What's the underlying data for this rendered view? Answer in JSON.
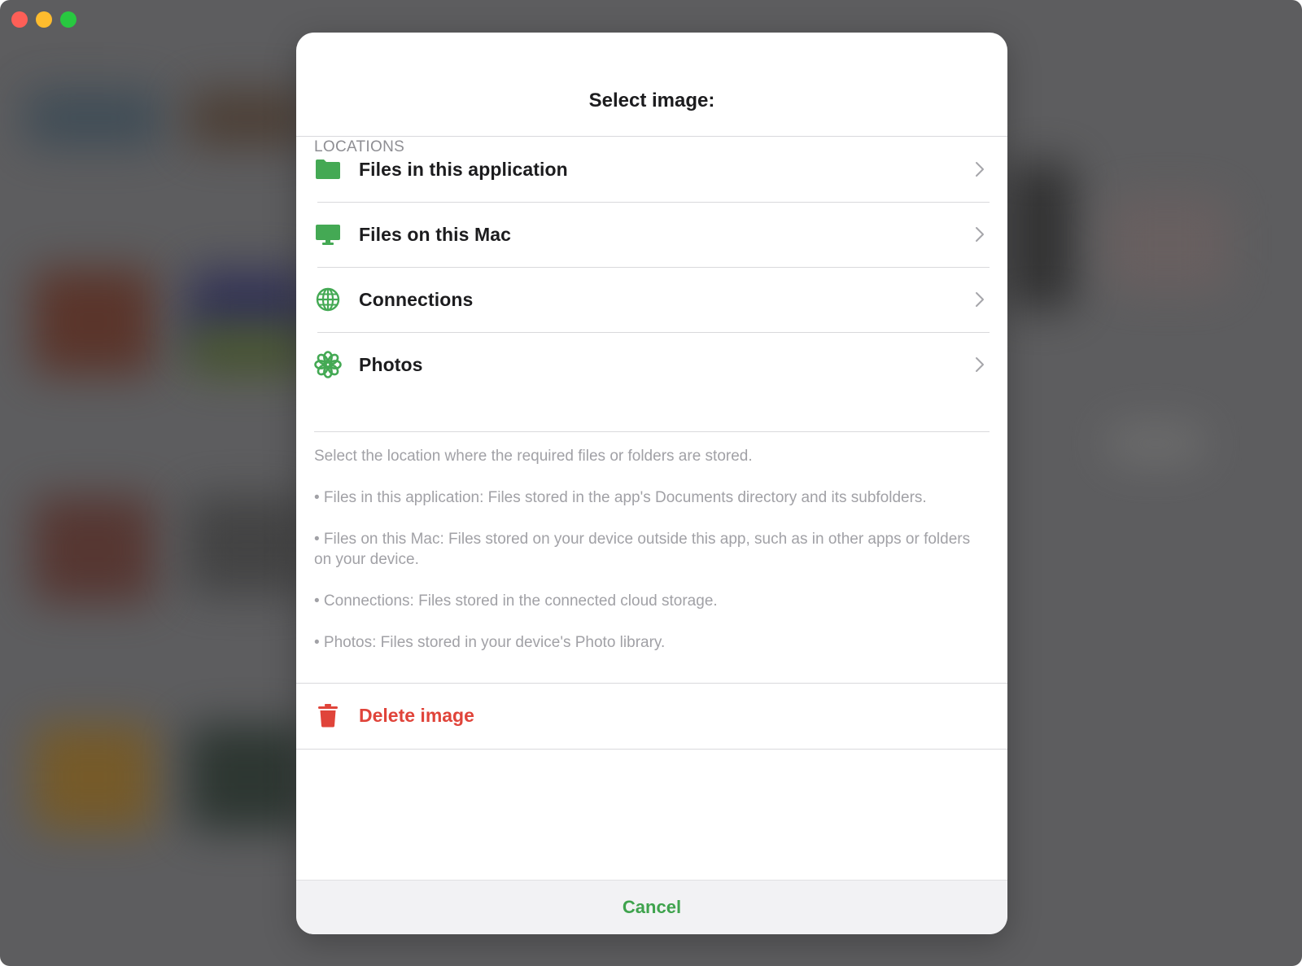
{
  "dialog": {
    "title": "Select image:",
    "section_header": "LOCATIONS",
    "locations": [
      {
        "label": "Files in this application",
        "icon": "folder-icon"
      },
      {
        "label": "Files on this Mac",
        "icon": "desktop-icon"
      },
      {
        "label": "Connections",
        "icon": "globe-icon"
      },
      {
        "label": "Photos",
        "icon": "photos-flower-icon"
      }
    ],
    "footer": [
      "Select the location where the required files or folders are stored.",
      "• Files in this application: Files stored in the app's Documents directory and its subfolders.",
      "• Files on this Mac: Files stored on your device outside this app, such as in other apps or folders on your device.",
      "• Connections: Files stored in the connected cloud storage.",
      "• Photos: Files stored in your device's Photo library."
    ],
    "delete_label": "Delete image",
    "cancel_label": "Cancel"
  },
  "colors": {
    "accent_green": "#3fa34d",
    "icon_green": "#44a954",
    "destructive_red": "#e0443a",
    "overlay": "#5d5d5f"
  }
}
